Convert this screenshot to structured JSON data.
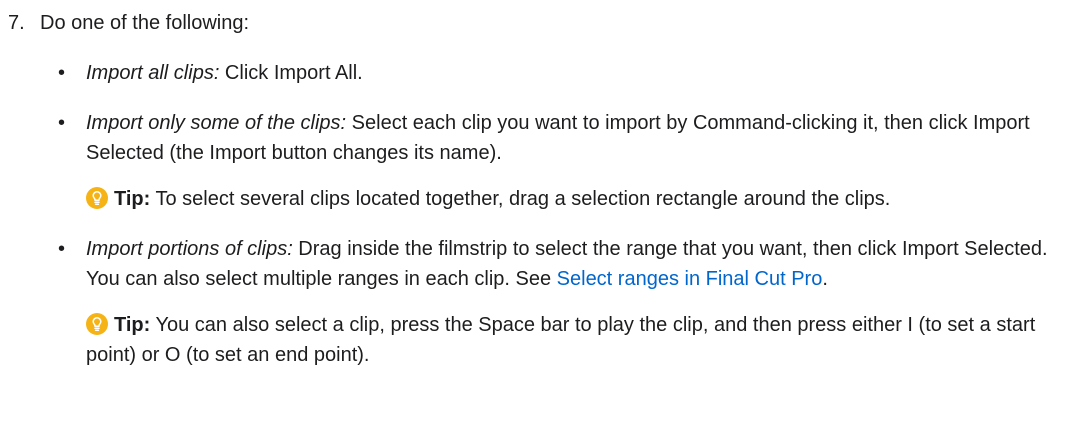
{
  "step": {
    "number": "7.",
    "intro": "Do one of the following:"
  },
  "bullets": [
    {
      "label": "Import all clips:",
      "text": " Click Import All."
    },
    {
      "label": "Import only some of the clips:",
      "text": " Select each clip you want to import by Command-clicking it, then click Import Selected (the Import button changes its name).",
      "tip": {
        "label": "Tip:",
        "text": " To select several clips located together, drag a selection rectangle around the clips."
      }
    },
    {
      "label": "Import portions of clips:",
      "text": " Drag inside the filmstrip to select the range that you want, then click Import Selected. You can also select multiple ranges in each clip. See ",
      "link": "Select ranges in Final Cut Pro",
      "text_after": ".",
      "tip": {
        "label": "Tip:",
        "text": " You can also select a clip, press the Space bar to play the clip, and then press either I (to set a start point) or O (to set an end point)."
      }
    }
  ],
  "colors": {
    "text": "#1d1d1f",
    "link": "#0066cc",
    "tip_icon": "#f5b316"
  },
  "icons": {
    "tip": "lightbulb-icon",
    "bullet": "•"
  }
}
